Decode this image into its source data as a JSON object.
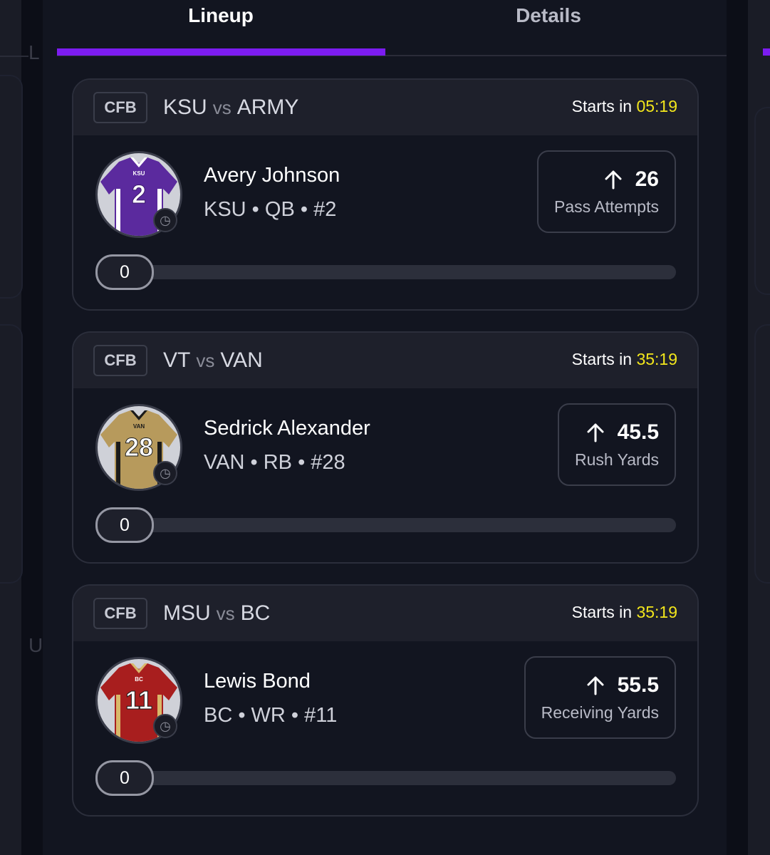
{
  "tabs": {
    "lineup": "Lineup",
    "details": "Details"
  },
  "background": {
    "letter_top": "L",
    "letter_bottom": "U"
  },
  "cards": [
    {
      "league": "CFB",
      "home": "KSU",
      "vs": "vs",
      "away": "ARMY",
      "starts_label": "Starts in",
      "timer": "05:19",
      "player": "Avery Johnson",
      "meta": "KSU • QB • #2",
      "stat_value": "26",
      "stat_label": "Pass Attempts",
      "progress": "0",
      "progress_fraction": 0,
      "jersey": {
        "color": "#5b2a9e",
        "trim": "#ffffff",
        "number": "2",
        "tag": "KSU"
      }
    },
    {
      "league": "CFB",
      "home": "VT",
      "vs": "vs",
      "away": "VAN",
      "starts_label": "Starts in",
      "timer": "35:19",
      "player": "Sedrick Alexander",
      "meta": "VAN • RB • #28",
      "stat_value": "45.5",
      "stat_label": "Rush Yards",
      "progress": "0",
      "progress_fraction": 0,
      "jersey": {
        "color": "#b79a5c",
        "trim": "#1a1a1a",
        "number": "28",
        "tag": "VAN"
      }
    },
    {
      "league": "CFB",
      "home": "MSU",
      "vs": "vs",
      "away": "BC",
      "starts_label": "Starts in",
      "timer": "35:19",
      "player": "Lewis Bond",
      "meta": "BC • WR • #11",
      "stat_value": "55.5",
      "stat_label": "Receiving Yards",
      "progress": "0",
      "progress_fraction": 0,
      "jersey": {
        "color": "#a81e1e",
        "trim": "#d9b86a",
        "number": "11",
        "tag": "BC"
      }
    }
  ]
}
